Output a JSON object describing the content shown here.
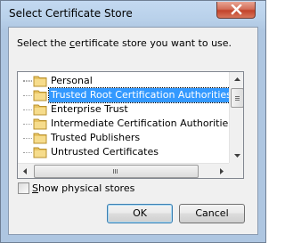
{
  "window": {
    "title": "Select Certificate Store"
  },
  "dialog": {
    "prompt": "Select the certificate store you want to use.",
    "prompt_mnemonic": "c"
  },
  "tree": {
    "items": [
      {
        "label": "Personal",
        "selected": false
      },
      {
        "label": "Trusted Root Certification Authorities",
        "selected": true
      },
      {
        "label": "Enterprise Trust",
        "selected": false
      },
      {
        "label": "Intermediate Certification Authorities",
        "selected": false
      },
      {
        "label": "Trusted Publishers",
        "selected": false
      },
      {
        "label": "Untrusted Certificates",
        "selected": false
      }
    ]
  },
  "checkbox": {
    "label": "Show physical stores",
    "checked": false
  },
  "buttons": {
    "ok": "OK",
    "cancel": "Cancel"
  },
  "colors": {
    "selection": "#3399ff",
    "folder": "#e8c463",
    "close_button": "#c2432a"
  },
  "icons": {
    "close": "close-icon",
    "folder": "folder-icon",
    "scroll_up": "scroll-up-arrow-icon",
    "scroll_down": "scroll-down-arrow-icon",
    "scroll_left": "scroll-left-arrow-icon",
    "scroll_right": "scroll-right-arrow-icon"
  }
}
